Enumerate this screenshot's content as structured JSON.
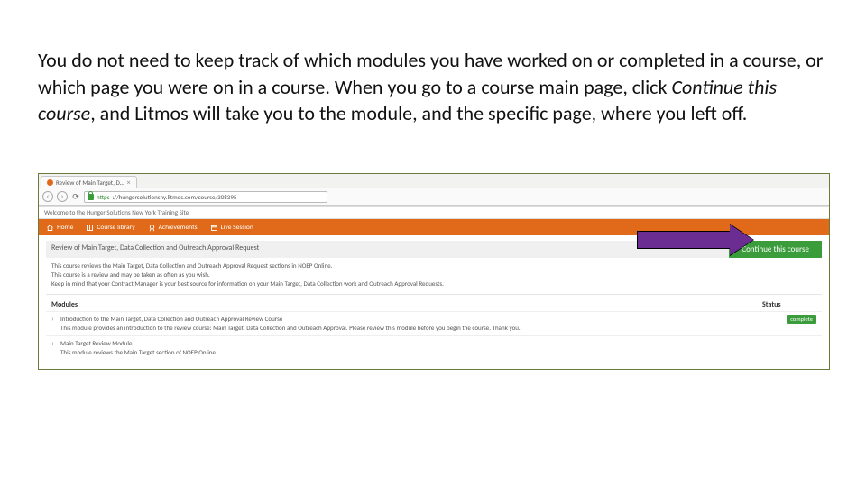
{
  "intro": {
    "part1": "You do not need to keep track of which modules you have worked on or completed in a course, or which page you were on in a course. When you go to a course main page, click ",
    "italic": "Continue this course",
    "part2": ", and Litmos will take you to the module, and the specific page, where you left off."
  },
  "browser": {
    "tab_label": "Review of Main Target, D…",
    "tab_close": "×",
    "https_label": "https",
    "url": "://hungersolutionsny.litmos.com/course/308395"
  },
  "welcome_strip": "Welcome to the Hunger Solutions New York Training Site",
  "nav": {
    "home": "Home",
    "library": "Course library",
    "achievements": "Achievements",
    "live": "Live Session"
  },
  "course": {
    "title": "Review of Main Target, Data Collection and Outreach Approval Request",
    "continue_label": "Continue this course",
    "desc1": "This course reviews the Main Target, Data Collection and Outreach Approval Request sections in NOEP Online.",
    "desc2": "This course is a review and may be taken as often as you wish.",
    "desc3": "Keep in mind that your Contract Manager is your best source for information on your Main Target, Data Collection work and Outreach Approval Requests."
  },
  "modules_header": {
    "title": "Modules",
    "status": "Status"
  },
  "modules": [
    {
      "title": "Introduction to the Main Target, Data Collection and Outreach Approval Review Course",
      "desc": "This module provides an introduction to the review course: Main Target, Data Collection and Outreach Approval. Please review this module before you begin the course. Thank you.",
      "status_label": "complete",
      "chevron": "›"
    },
    {
      "title": "Main Target Review Module",
      "desc": "This module reviews the Main Target section of NOEP Online.",
      "status_label": "",
      "chevron": "›"
    }
  ]
}
